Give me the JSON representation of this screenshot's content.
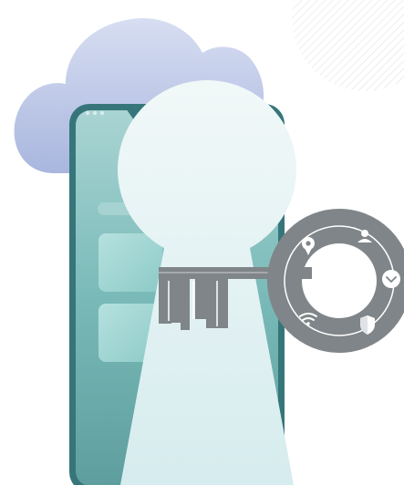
{
  "illustration": {
    "subject": "",
    "colors": {
      "cloud": "#b7c3e4",
      "phone_frame": "#36767a",
      "phone_screen": "#7fbfbd",
      "keyhole": "#e3f2f3",
      "key": "#7f8588",
      "key_icons": "#ffffff",
      "hatch": "#e2e6ea"
    },
    "key_ring_icons": [
      "location-pin-icon",
      "user-icon",
      "check-circle-icon",
      "shield-icon",
      "wifi-icon"
    ]
  }
}
